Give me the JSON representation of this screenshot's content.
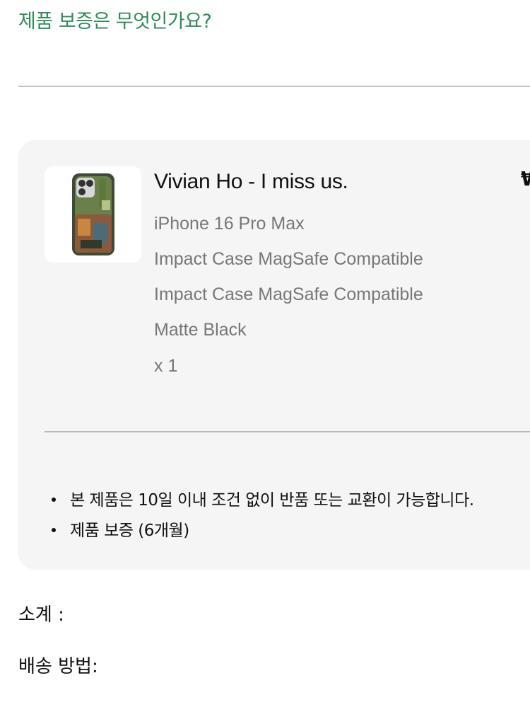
{
  "warranty_question": "제품 보증은 무엇인가요?",
  "product": {
    "name": "Vivian Ho - I miss us.",
    "price_fragment": "₩",
    "device": "iPhone 16 Pro Max",
    "case_type_1": "Impact Case MagSafe Compatible",
    "case_type_2": "Impact Case MagSafe Compatible",
    "finish": "Matte Black",
    "quantity": "x 1",
    "thumbnail_icon": "phone-case-thumbnail"
  },
  "notes": [
    "본 제품은 10일 이내 조건 없이 반품 또는 교환이 가능합니다.",
    "제품 보증 (6개월)"
  ],
  "summary": {
    "subtotal_label": "소계 :",
    "shipping_label": "배송 방법:"
  },
  "colors": {
    "accent_green": "#2e8b57",
    "card_bg": "#f5f5f5",
    "secondary_text": "#777777"
  }
}
